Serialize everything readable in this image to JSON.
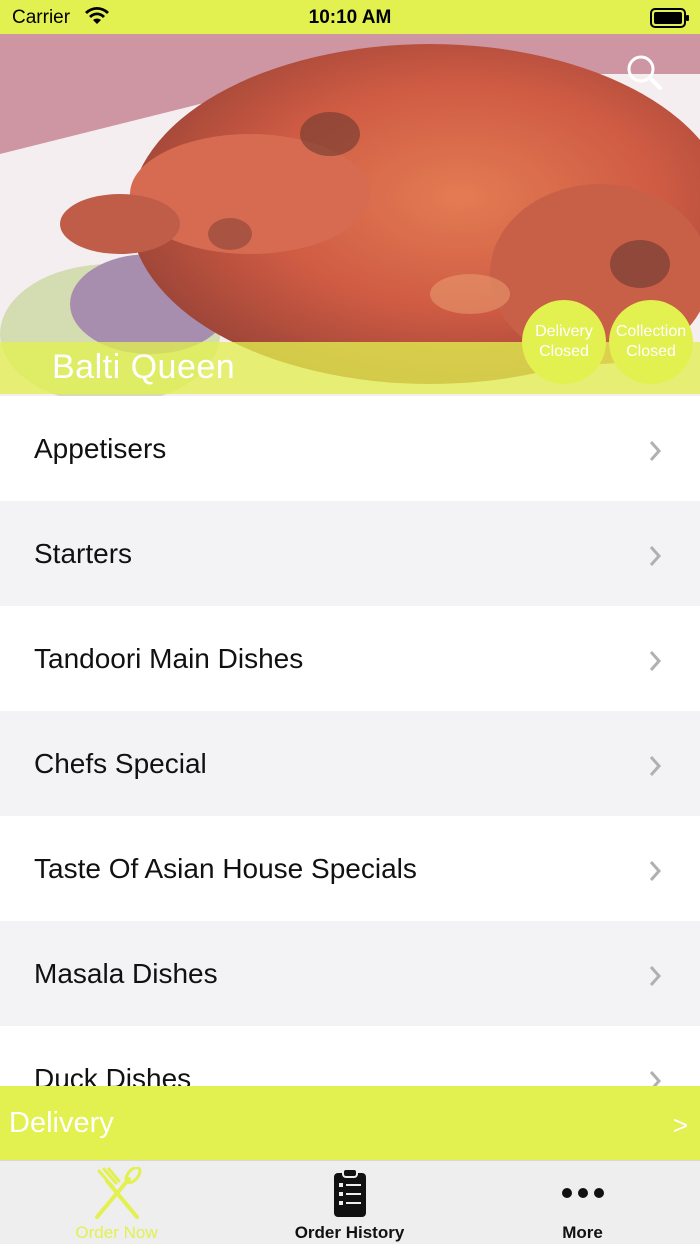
{
  "status_bar": {
    "carrier": "Carrier",
    "time": "10:10 AM",
    "wifi_icon": "wifi-icon",
    "battery_icon": "battery-icon"
  },
  "header": {
    "restaurant_name": "Balti Queen",
    "search_icon": "search-icon",
    "delivery_status": {
      "line1": "Delivery",
      "line2": "Closed"
    },
    "collection_status": {
      "line1": "Collection",
      "line2": "Closed"
    }
  },
  "menu": {
    "items": [
      {
        "label": "Appetisers"
      },
      {
        "label": "Starters"
      },
      {
        "label": "Tandoori Main Dishes"
      },
      {
        "label": "Chefs Special"
      },
      {
        "label": "Taste Of Asian House Specials"
      },
      {
        "label": "Masala Dishes"
      },
      {
        "label": "Duck Dishes"
      }
    ],
    "chevron_icon": "chevron-right-icon"
  },
  "order_mode": {
    "label": "Delivery",
    "arrow": ">"
  },
  "tab_bar": {
    "tabs": [
      {
        "label": "Order Now",
        "icon": "fork-knife-icon",
        "active": true
      },
      {
        "label": "Order History",
        "icon": "clipboard-list-icon",
        "active": false
      },
      {
        "label": "More",
        "icon": "more-dots-icon",
        "active": false
      }
    ]
  },
  "colors": {
    "accent": "#e2f050",
    "row_alt": "#f3f3f5",
    "text": "#111111"
  }
}
